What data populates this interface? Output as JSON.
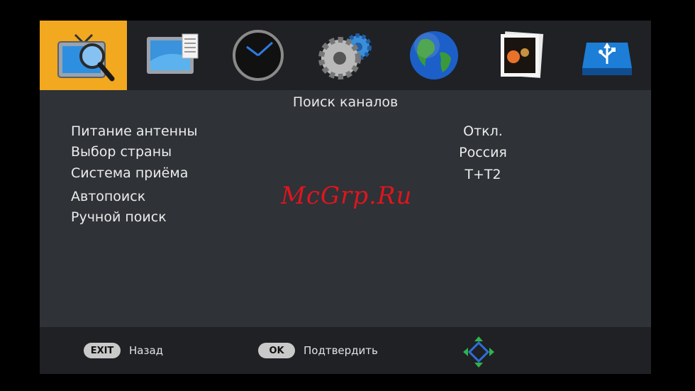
{
  "icons": [
    {
      "name": "channel-search-icon",
      "active": true
    },
    {
      "name": "tv-picture-icon",
      "active": false
    },
    {
      "name": "clock-icon",
      "active": false
    },
    {
      "name": "settings-gears-icon",
      "active": false
    },
    {
      "name": "globe-icon",
      "active": false
    },
    {
      "name": "media-photo-icon",
      "active": false
    },
    {
      "name": "usb-drive-icon",
      "active": false
    }
  ],
  "menu": {
    "title": "Поиск каналов",
    "items": [
      {
        "label": "Питание антенны",
        "value": "Откл."
      },
      {
        "label": "Выбор страны",
        "value": "Россия"
      },
      {
        "label": "Система приёма",
        "value": "T+T2"
      },
      {
        "label": "Автопоиск",
        "value": ""
      },
      {
        "label": "Ручной поиск",
        "value": ""
      }
    ]
  },
  "watermark": "McGrp.Ru",
  "footer": {
    "exit_key": "EXIT",
    "exit_label": "Назад",
    "ok_key": "OK",
    "ok_label": "Подтвердить"
  },
  "colors": {
    "accent": "#f2a81f",
    "panel": "#2f3237",
    "bar": "#1f2125"
  }
}
